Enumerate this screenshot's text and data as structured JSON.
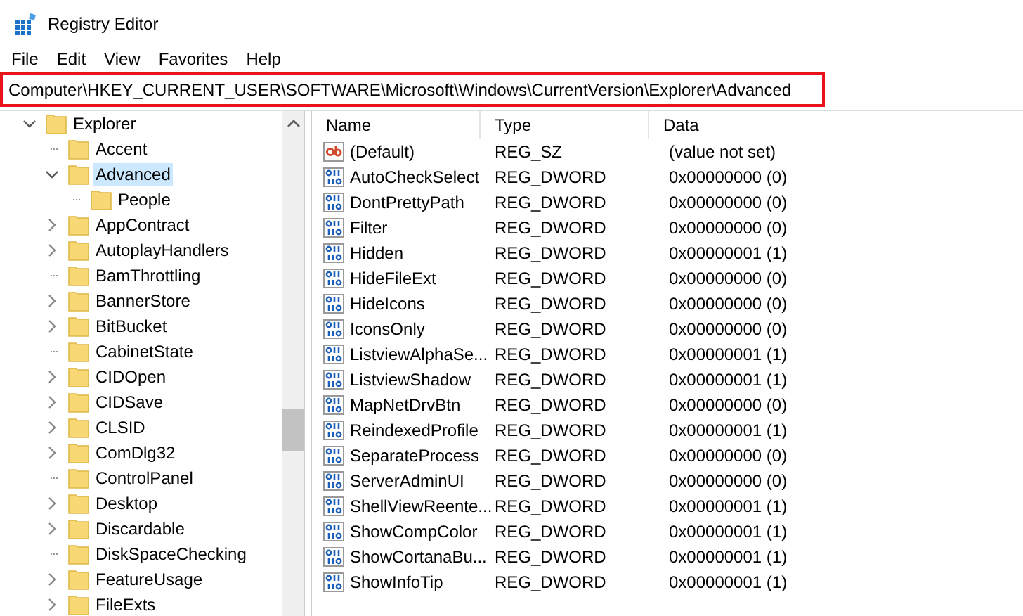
{
  "window": {
    "title": "Registry Editor"
  },
  "menu": [
    "File",
    "Edit",
    "View",
    "Favorites",
    "Help"
  ],
  "address": {
    "value": "Computer\\HKEY_CURRENT_USER\\SOFTWARE\\Microsoft\\Windows\\CurrentVersion\\Explorer\\Advanced",
    "highlighted": true
  },
  "tree": [
    {
      "label": "Explorer",
      "expandable": true,
      "expanded": true,
      "selected": false,
      "children": [
        {
          "label": "Accent",
          "expandable": false,
          "selected": false
        },
        {
          "label": "Advanced",
          "expandable": true,
          "expanded": true,
          "selected": true,
          "children": [
            {
              "label": "People",
              "expandable": false,
              "selected": false
            }
          ]
        },
        {
          "label": "AppContract",
          "expandable": true,
          "expanded": false,
          "selected": false
        },
        {
          "label": "AutoplayHandlers",
          "expandable": true,
          "expanded": false,
          "selected": false
        },
        {
          "label": "BamThrottling",
          "expandable": false,
          "selected": false
        },
        {
          "label": "BannerStore",
          "expandable": true,
          "expanded": false,
          "selected": false
        },
        {
          "label": "BitBucket",
          "expandable": true,
          "expanded": false,
          "selected": false
        },
        {
          "label": "CabinetState",
          "expandable": false,
          "selected": false
        },
        {
          "label": "CIDOpen",
          "expandable": true,
          "expanded": false,
          "selected": false
        },
        {
          "label": "CIDSave",
          "expandable": true,
          "expanded": false,
          "selected": false
        },
        {
          "label": "CLSID",
          "expandable": true,
          "expanded": false,
          "selected": false
        },
        {
          "label": "ComDlg32",
          "expandable": true,
          "expanded": false,
          "selected": false
        },
        {
          "label": "ControlPanel",
          "expandable": false,
          "selected": false
        },
        {
          "label": "Desktop",
          "expandable": true,
          "expanded": false,
          "selected": false
        },
        {
          "label": "Discardable",
          "expandable": true,
          "expanded": false,
          "selected": false
        },
        {
          "label": "DiskSpaceChecking",
          "expandable": false,
          "selected": false
        },
        {
          "label": "FeatureUsage",
          "expandable": true,
          "expanded": false,
          "selected": false
        },
        {
          "label": "FileExts",
          "expandable": true,
          "expanded": false,
          "selected": false
        }
      ]
    }
  ],
  "table": {
    "columns": [
      "Name",
      "Type",
      "Data"
    ],
    "rows": [
      {
        "kind": "string",
        "name": "(Default)",
        "type": "REG_SZ",
        "data": "(value not set)"
      },
      {
        "kind": "dword",
        "name": "AutoCheckSelect",
        "type": "REG_DWORD",
        "data": "0x00000000 (0)"
      },
      {
        "kind": "dword",
        "name": "DontPrettyPath",
        "type": "REG_DWORD",
        "data": "0x00000000 (0)"
      },
      {
        "kind": "dword",
        "name": "Filter",
        "type": "REG_DWORD",
        "data": "0x00000000 (0)"
      },
      {
        "kind": "dword",
        "name": "Hidden",
        "type": "REG_DWORD",
        "data": "0x00000001 (1)"
      },
      {
        "kind": "dword",
        "name": "HideFileExt",
        "type": "REG_DWORD",
        "data": "0x00000000 (0)"
      },
      {
        "kind": "dword",
        "name": "HideIcons",
        "type": "REG_DWORD",
        "data": "0x00000000 (0)"
      },
      {
        "kind": "dword",
        "name": "IconsOnly",
        "type": "REG_DWORD",
        "data": "0x00000000 (0)"
      },
      {
        "kind": "dword",
        "name": "ListviewAlphaSe...",
        "type": "REG_DWORD",
        "data": "0x00000001 (1)"
      },
      {
        "kind": "dword",
        "name": "ListviewShadow",
        "type": "REG_DWORD",
        "data": "0x00000001 (1)"
      },
      {
        "kind": "dword",
        "name": "MapNetDrvBtn",
        "type": "REG_DWORD",
        "data": "0x00000000 (0)"
      },
      {
        "kind": "dword",
        "name": "ReindexedProfile",
        "type": "REG_DWORD",
        "data": "0x00000001 (1)"
      },
      {
        "kind": "dword",
        "name": "SeparateProcess",
        "type": "REG_DWORD",
        "data": "0x00000000 (0)"
      },
      {
        "kind": "dword",
        "name": "ServerAdminUI",
        "type": "REG_DWORD",
        "data": "0x00000000 (0)"
      },
      {
        "kind": "dword",
        "name": "ShellViewReente...",
        "type": "REG_DWORD",
        "data": "0x00000001 (1)"
      },
      {
        "kind": "dword",
        "name": "ShowCompColor",
        "type": "REG_DWORD",
        "data": "0x00000001 (1)"
      },
      {
        "kind": "dword",
        "name": "ShowCortanaBu...",
        "type": "REG_DWORD",
        "data": "0x00000001 (1)"
      },
      {
        "kind": "dword",
        "name": "ShowInfoTip",
        "type": "REG_DWORD",
        "data": "0x00000001 (1)"
      }
    ]
  }
}
